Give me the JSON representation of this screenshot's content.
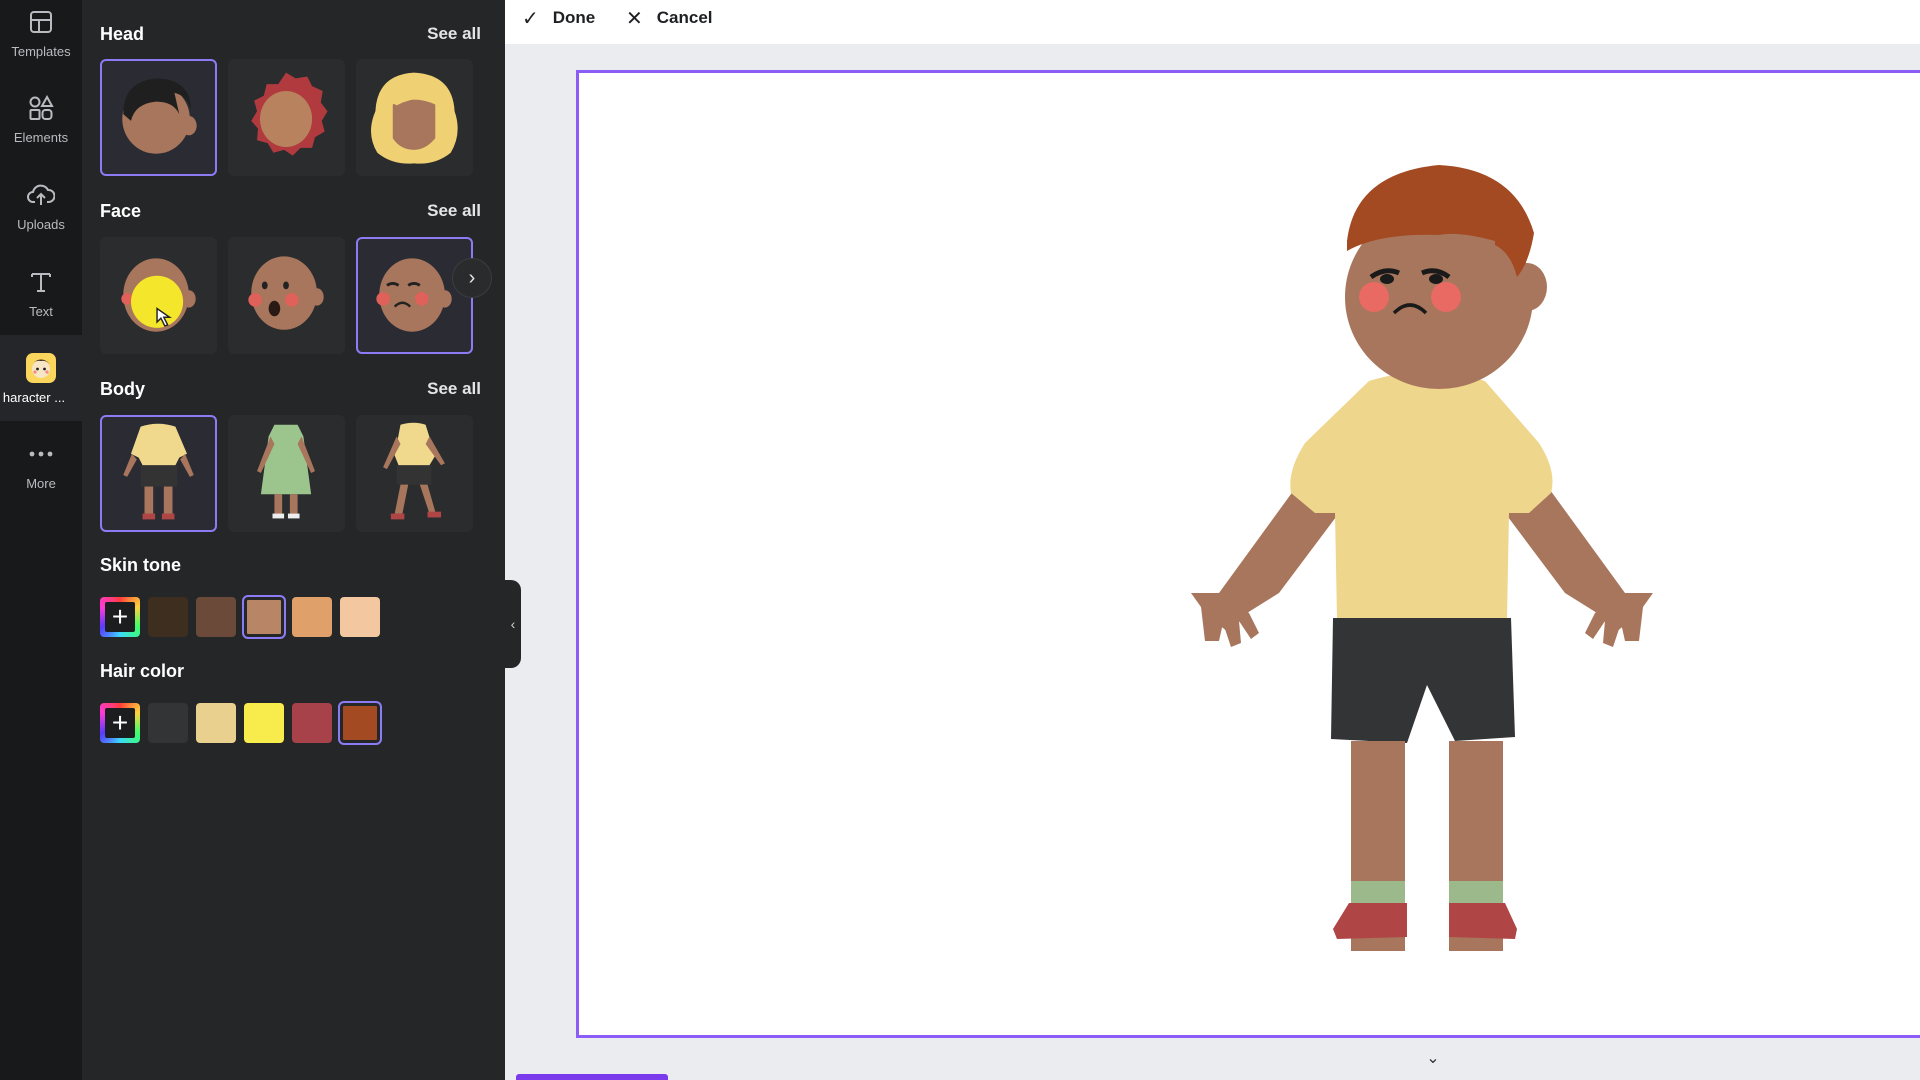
{
  "rail": {
    "items": [
      {
        "label": "Templates",
        "icon": "templates-icon"
      },
      {
        "label": "Elements",
        "icon": "elements-icon"
      },
      {
        "label": "Uploads",
        "icon": "upload-cloud-icon"
      },
      {
        "label": "Text",
        "icon": "text-icon"
      },
      {
        "label": "haracter ...",
        "icon": "character-icon"
      },
      {
        "label": "More",
        "icon": "more-dots-icon"
      }
    ]
  },
  "panel": {
    "head": {
      "title": "Head",
      "see_all": "See all"
    },
    "face": {
      "title": "Face",
      "see_all": "See all"
    },
    "body": {
      "title": "Body",
      "see_all": "See all"
    },
    "skin_tone": {
      "title": "Skin tone",
      "swatches": [
        "#3d2e1f",
        "#6b4a3a",
        "#b88566",
        "#e0a06a",
        "#f3c8a0"
      ],
      "selected": "#b88566"
    },
    "hair_color": {
      "title": "Hair color",
      "swatches": [
        "#333436",
        "#e9d08f",
        "#f7ec4b",
        "#a8424a",
        "#a34a22"
      ],
      "selected": "#a34a22"
    },
    "next_icon": "chevron-right-icon",
    "collapse_icon": "chevron-left-icon"
  },
  "topbar": {
    "done_label": "Done",
    "cancel_label": "Cancel"
  },
  "colors": {
    "accent": "#8b5cf6",
    "panel_bg": "#252627",
    "rail_bg": "#18191b"
  }
}
